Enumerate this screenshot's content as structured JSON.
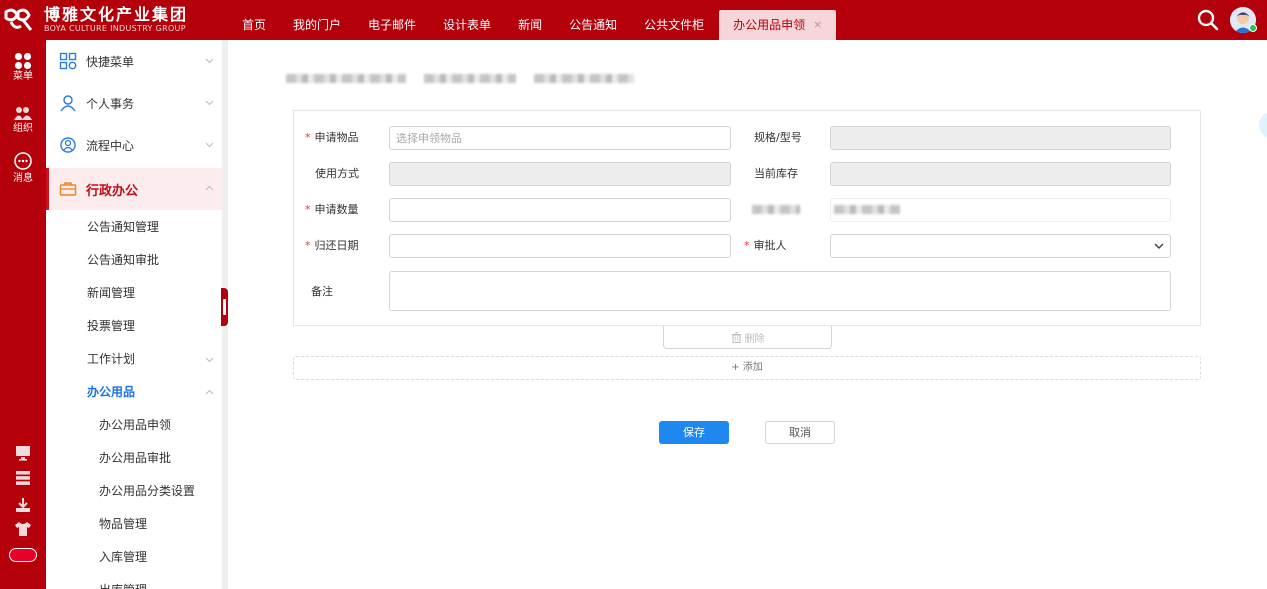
{
  "brand": {
    "name_cn": "博雅文化产业集团",
    "name_en": "BOYA CULTURE INDUSTRY GROUP",
    "tm": "™"
  },
  "colors": {
    "brand_red": "#b3000b",
    "accent_blue": "#1e88f0",
    "required_red": "#e53935"
  },
  "topnav": {
    "items": [
      "首页",
      "我的门户",
      "电子邮件",
      "设计表单",
      "新闻",
      "公告通知",
      "公共文件柜"
    ],
    "active_tab": {
      "label": "办公用品申领",
      "close": "×"
    },
    "search_icon": "search-icon",
    "avatar_icon": "user-avatar"
  },
  "rail": {
    "items": [
      {
        "icon": "grid-icon",
        "label": "菜单"
      },
      {
        "icon": "people-icon",
        "label": "组织"
      },
      {
        "icon": "chat-icon",
        "label": "消息"
      }
    ],
    "tools": [
      "monitor-icon",
      "server-icon",
      "download-icon",
      "shirt-icon",
      "toggle-pill-icon"
    ]
  },
  "sidebar": {
    "menus": [
      {
        "label": "快捷菜单",
        "icon": "quick-menu-icon"
      },
      {
        "label": "个人事务",
        "icon": "person-icon"
      },
      {
        "label": "流程中心",
        "icon": "flow-icon"
      },
      {
        "label": "行政办公",
        "icon": "briefcase-icon"
      }
    ],
    "sub": {
      "notice_mgmt": "公告通知管理",
      "notice_review": "公告通知审批",
      "news_mgmt": "新闻管理",
      "vote_mgmt": "投票管理",
      "work_plan": "工作计划",
      "office_supplies": "办公用品",
      "supplies_apply": "办公用品申领",
      "supplies_review": "办公用品审批",
      "supplies_category": "办公用品分类设置",
      "items_mgmt": "物品管理",
      "stock_in": "入库管理",
      "stock_out": "出库管理"
    }
  },
  "form": {
    "item": {
      "label": "申请物品",
      "placeholder": "选择申领物品",
      "value": ""
    },
    "spec": {
      "label": "规格/型号",
      "value": ""
    },
    "usage": {
      "label": "使用方式",
      "value": ""
    },
    "stock": {
      "label": "当前库存",
      "value": ""
    },
    "quantity": {
      "label": "申请数量",
      "value": ""
    },
    "return_date": {
      "label": "归还日期",
      "value": ""
    },
    "approver": {
      "label": "审批人",
      "value": ""
    },
    "remark": {
      "label": "备注",
      "value": ""
    },
    "required_mark": "*"
  },
  "actions": {
    "delete": "删除",
    "add": "+ 添加",
    "save": "保存",
    "cancel": "取消"
  }
}
